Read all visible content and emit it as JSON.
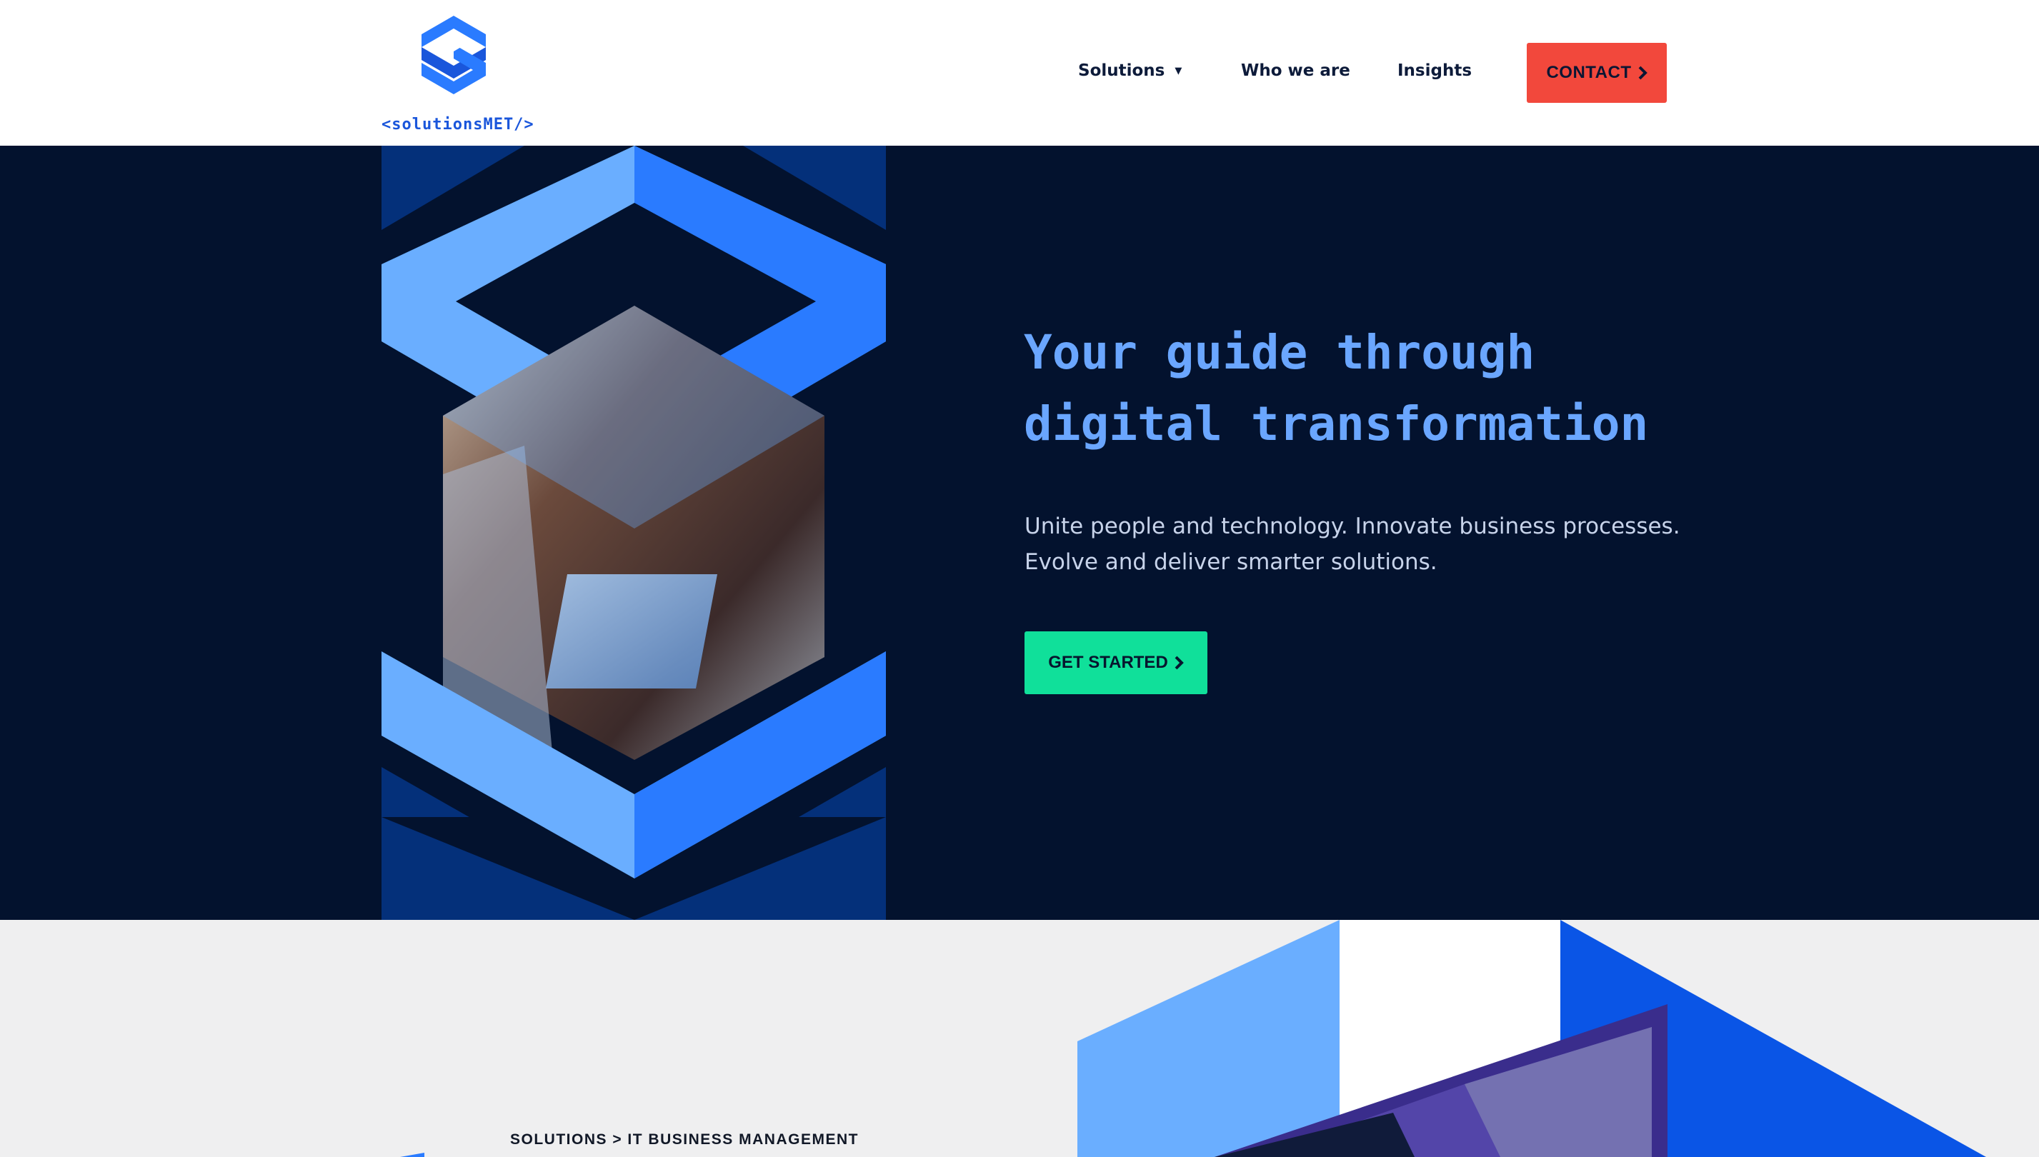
{
  "header": {
    "logo_text": "<solutionsMET/>",
    "nav": [
      {
        "label": "Solutions"
      },
      {
        "label": "Who we are"
      },
      {
        "label": "Insights"
      }
    ],
    "contact_label": "CONTACT"
  },
  "hero": {
    "title_line1": "Your guide through",
    "title_line2": "digital transformation",
    "subtitle_line1": "Unite people and technology. Innovate business processes.",
    "subtitle_line2": "Evolve and deliver smarter solutions.",
    "cta_label": "GET STARTED"
  },
  "lower": {
    "breadcrumb": "SOLUTIONS > IT BUSINESS MANAGEMENT"
  },
  "colors": {
    "navy": "#03122e",
    "accent_blue": "#2a7bff",
    "light_blue": "#6aaeff",
    "contact_red": "#f2483c",
    "cta_green": "#10e09a"
  },
  "icons": {
    "caret": "caret-down-icon",
    "chevron": "chevron-right-icon"
  }
}
